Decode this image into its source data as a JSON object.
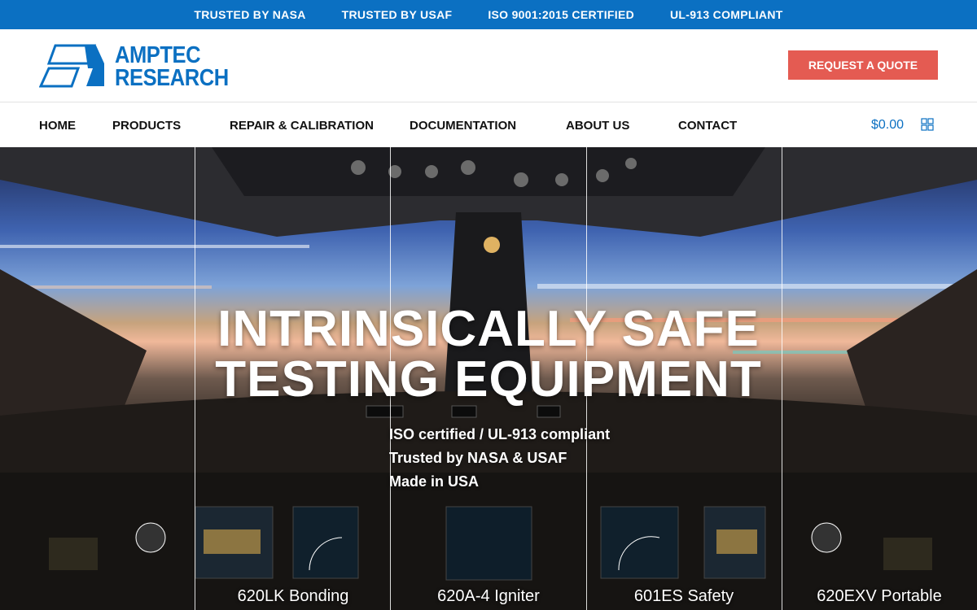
{
  "topbar": {
    "items": [
      "TRUSTED BY NASA",
      "TRUSTED BY USAF",
      "ISO 9001:2015 CERTIFIED",
      "UL-913 COMPLIANT"
    ]
  },
  "brand": {
    "line1": "AMPTEC",
    "line2": "RESEARCH",
    "color": "#0b70c2",
    "logo_icon": "parallelogram-mark-icon"
  },
  "header": {
    "quote_button": "REQUEST A QUOTE",
    "quote_color": "#e45b52"
  },
  "nav": {
    "items": [
      "HOME",
      "PRODUCTS",
      "REPAIR & CALIBRATION",
      "DOCUMENTATION",
      "ABOUT US",
      "CONTACT"
    ],
    "cart_total": "$0.00",
    "cart_icon": "grid-cart-icon"
  },
  "hero": {
    "title_line1": "INTRINSICALLY SAFE",
    "title_line2": "TESTING EQUIPMENT",
    "subtitles": [
      "ISO certified / UL-913 compliant",
      "Trusted by NASA & USAF",
      "Made in USA"
    ],
    "products": [
      "620LK Bonding",
      "620A-4 Igniter",
      "601ES Safety",
      "620EXV Portable"
    ],
    "background": "aircraft-cockpit-photo"
  }
}
